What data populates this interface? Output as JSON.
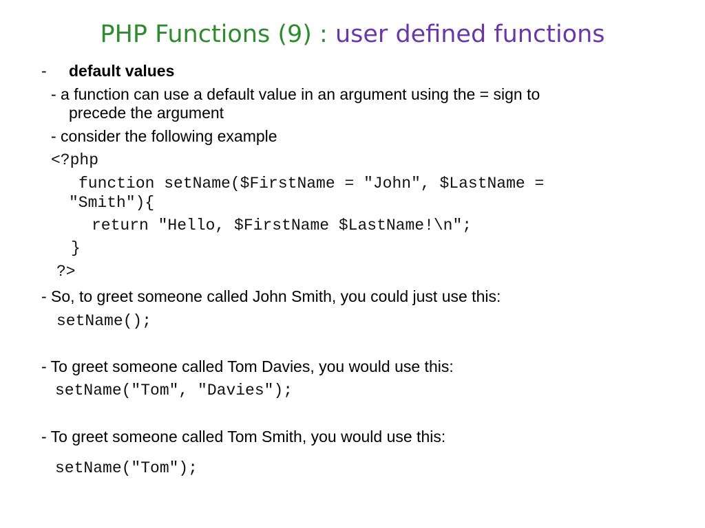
{
  "slide": {
    "title_part1": "PHP Functions (9) : ",
    "title_part2": "user defined functions",
    "heading_dash": "-",
    "heading": "default values",
    "desc1_line1": "- a function can use a default value in an argument using the = sign to",
    "desc1_line2": "precede the argument",
    "desc2": "- consider the following example",
    "code": {
      "open_tag": "<?php",
      "func_line1": "function setName($FirstName = \"John\", $LastName =",
      "func_line2": "\"Smith\"){",
      "return_line": "return \"Hello, $FirstName $LastName!\\n\";",
      "close_brace": "}",
      "close_tag": "?>"
    },
    "example1_text": "- So, to greet someone called John Smith, you could just use this:",
    "example1_code": "setName();",
    "example2_text": "- To greet someone called Tom Davies, you would use this:",
    "example2_code": "setName(\"Tom\", \"Davies\");",
    "example3_text": "- To greet someone called Tom Smith, you would use this:",
    "example3_code": "setName(\"Tom\");"
  }
}
